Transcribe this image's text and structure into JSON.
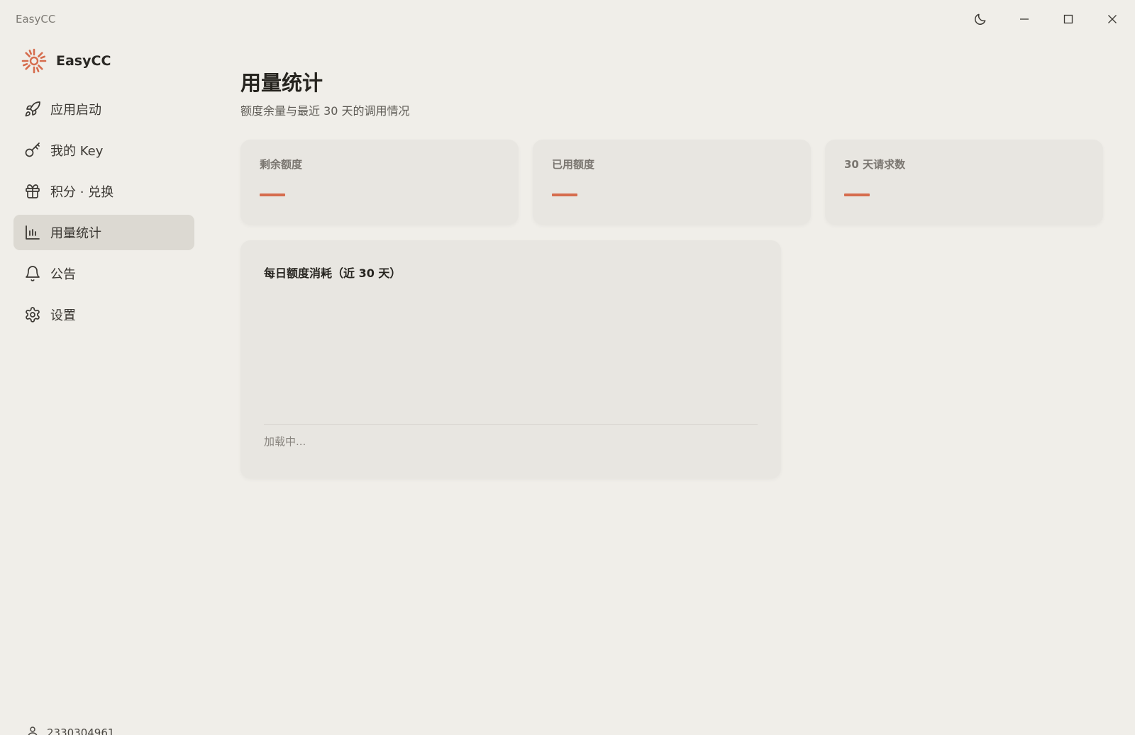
{
  "window": {
    "title": "EasyCC",
    "controls": [
      "moon-icon",
      "minimize-icon",
      "maximize-icon",
      "close-icon"
    ]
  },
  "sidebar": {
    "brand": "EasyCC",
    "items": [
      {
        "label": "应用启动",
        "icon": "rocket-icon",
        "active": false
      },
      {
        "label": "我的 Key",
        "icon": "key-icon",
        "active": false
      },
      {
        "label": "积分 · 兑换",
        "icon": "gift-icon",
        "active": false
      },
      {
        "label": "用量统计",
        "icon": "bar-chart-icon",
        "active": true
      },
      {
        "label": "公告",
        "icon": "bell-icon",
        "active": false
      },
      {
        "label": "设置",
        "icon": "gear-icon",
        "active": false
      }
    ],
    "user": {
      "id": "2330304961",
      "icon": "user-icon"
    }
  },
  "main": {
    "title": "用量统计",
    "subtitle": "额度余量与最近 30 天的调用情况",
    "stats": [
      {
        "label": "剩余额度",
        "value": "—"
      },
      {
        "label": "已用额度",
        "value": "—"
      },
      {
        "label": "30 天请求数",
        "value": "—"
      }
    ],
    "chart": {
      "title": "每日额度消耗（近 30 天）",
      "status": "加载中..."
    }
  },
  "colors": {
    "accent": "#d66c4d",
    "background": "#f0eee9",
    "card": "#e8e6e1",
    "active_nav": "#dcd9d2"
  }
}
